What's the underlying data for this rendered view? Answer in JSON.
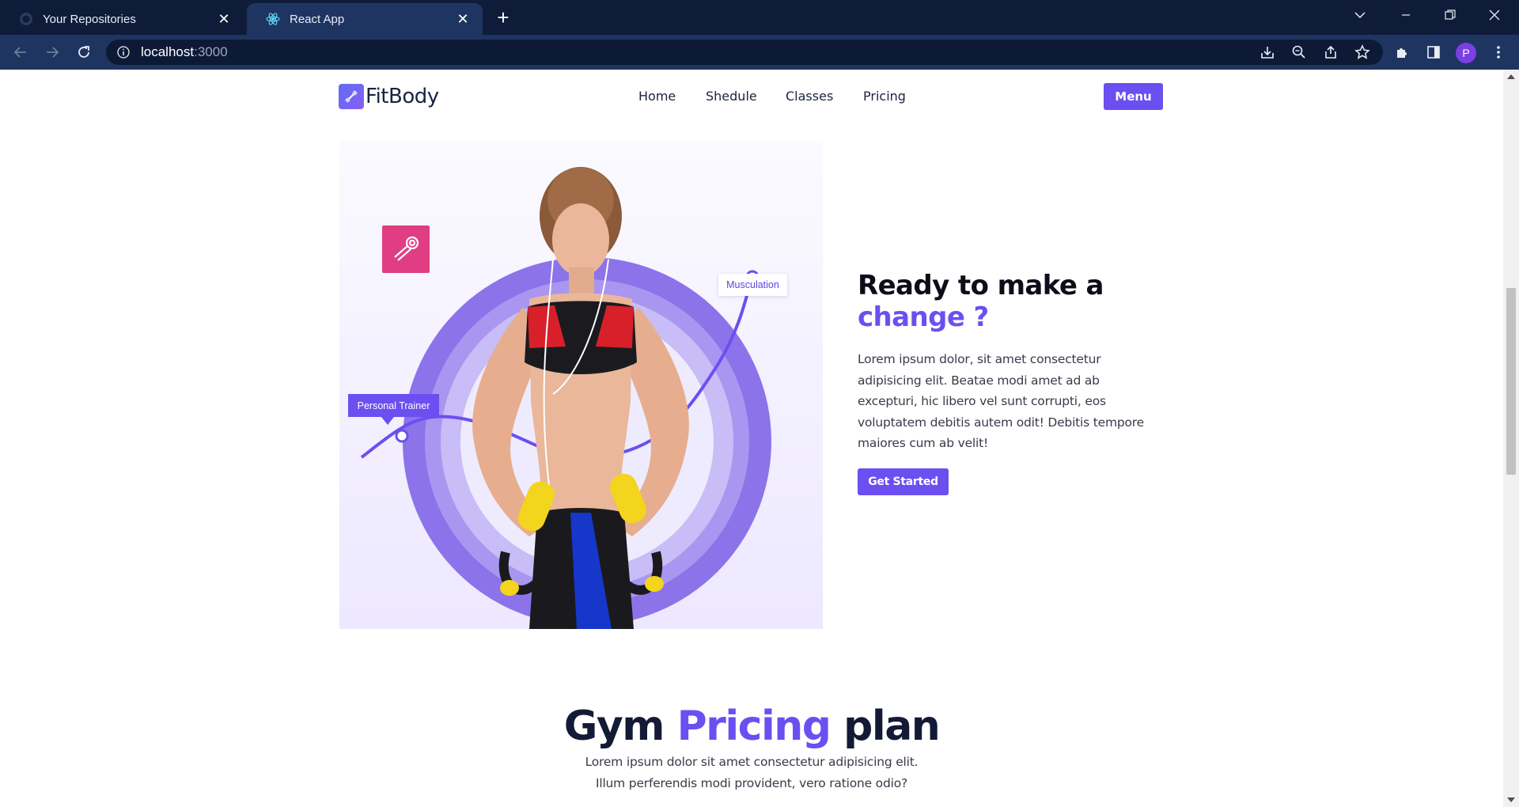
{
  "browser": {
    "tabs": [
      {
        "title": "Your Repositories",
        "icon": "github-icon",
        "active": false
      },
      {
        "title": "React App",
        "icon": "react-icon",
        "active": true
      }
    ],
    "url_host": "localhost",
    "url_port": ":3000",
    "profile_initial": "P"
  },
  "site": {
    "brand": "FitBody",
    "nav": [
      "Home",
      "Shedule",
      "Classes",
      "Pricing"
    ],
    "menu_button": "Menu",
    "accent_color": "#6b4ff0"
  },
  "hero": {
    "tag_musculation": "Musculation",
    "tag_trainer": "Personal Trainer",
    "heading_line1": "Ready to make a",
    "heading_accent": "change ?",
    "paragraph": "Lorem ipsum dolor, sit amet consectetur adipisicing elit. Beatae modi amet ad ab excepturi, hic libero vel sunt corrupti, eos voluptatem debitis autem odit! Debitis tempore maiores cum ab velit!",
    "cta": "Get Started"
  },
  "pricing": {
    "heading_before": "Gym",
    "heading_accent": "Pricing",
    "heading_after": "plan",
    "line1": "Lorem ipsum dolor sit amet consectetur adipisicing elit.",
    "line2": "Illum perferendis modi provident, vero ratione odio?"
  }
}
